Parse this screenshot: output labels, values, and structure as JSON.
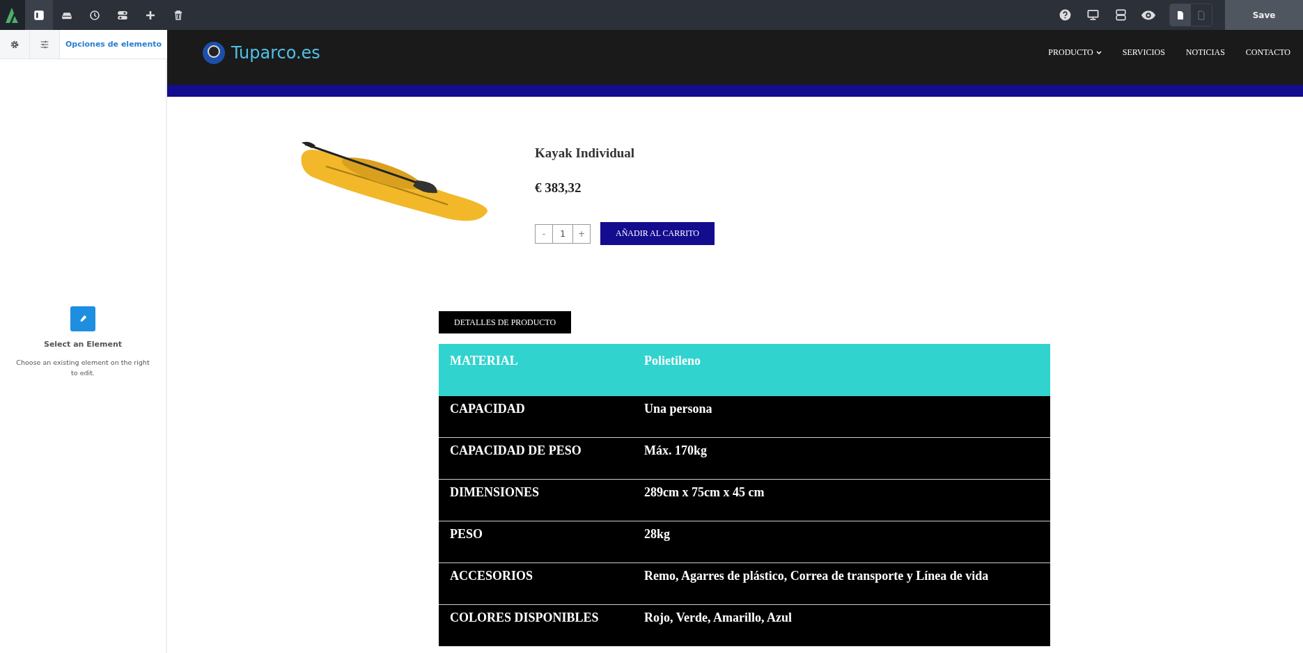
{
  "toolbar": {
    "tools": [
      {
        "kind": "panel",
        "selected": true
      },
      {
        "kind": "drive",
        "selected": false
      },
      {
        "kind": "history",
        "selected": false
      },
      {
        "kind": "toggle",
        "selected": false
      },
      {
        "kind": "add",
        "selected": false
      },
      {
        "kind": "delete",
        "selected": false
      }
    ],
    "right_tools": [
      {
        "kind": "help"
      },
      {
        "kind": "desktop"
      },
      {
        "kind": "rows"
      },
      {
        "kind": "preview"
      }
    ],
    "page_modes": [
      {
        "kind": "page-filled",
        "selected": true
      },
      {
        "kind": "page-outline",
        "selected": false
      }
    ],
    "save_button": "Save"
  },
  "side_panel": {
    "tabs": [
      {
        "kind": "gear",
        "selected": false
      },
      {
        "kind": "sliders",
        "selected": false
      },
      {
        "kind": "text",
        "label": "Opciones de elemento",
        "selected": true
      }
    ],
    "empty_state": {
      "title": "Select an Element",
      "description": "Choose an existing element on the right to edit."
    }
  },
  "site_header": {
    "logo": "Tuparco.es",
    "nav": [
      {
        "label": "PRODUCTO",
        "has_menu": true
      },
      {
        "label": "SERVICIOS",
        "has_menu": false
      },
      {
        "label": "NOTICIAS",
        "has_menu": false
      },
      {
        "label": "CONTACTO",
        "has_menu": false
      }
    ]
  },
  "product": {
    "title": "Kayak Individual",
    "price": "€ 383,32",
    "quantity": {
      "minus": "-",
      "value": "1",
      "plus": "+"
    },
    "add_to_cart": "AÑADIR AL CARRITO"
  },
  "details_tab": "DETALLES DE PRODUCTO",
  "specs": [
    {
      "label": "MATERIAL",
      "value": "Polietileno",
      "highlighted": true
    },
    {
      "label": "CAPACIDAD",
      "value": "Una persona",
      "highlighted": false
    },
    {
      "label": "CAPACIDAD DE PESO",
      "value": "Máx. 170kg",
      "highlighted": false
    },
    {
      "label": "DIMENSIONES",
      "value": "289cm x 75cm x 45 cm",
      "highlighted": false
    },
    {
      "label": "PESO",
      "value": "28kg",
      "highlighted": false
    },
    {
      "label": "ACCESORIOS",
      "value": "Remo, Agarres de plástico, Correa de transporte y Línea de vida",
      "highlighted": false
    },
    {
      "label": "COLORES DISPONIBLES",
      "value": "Rojo, Verde, Amarillo, Azul",
      "highlighted": false
    }
  ]
}
